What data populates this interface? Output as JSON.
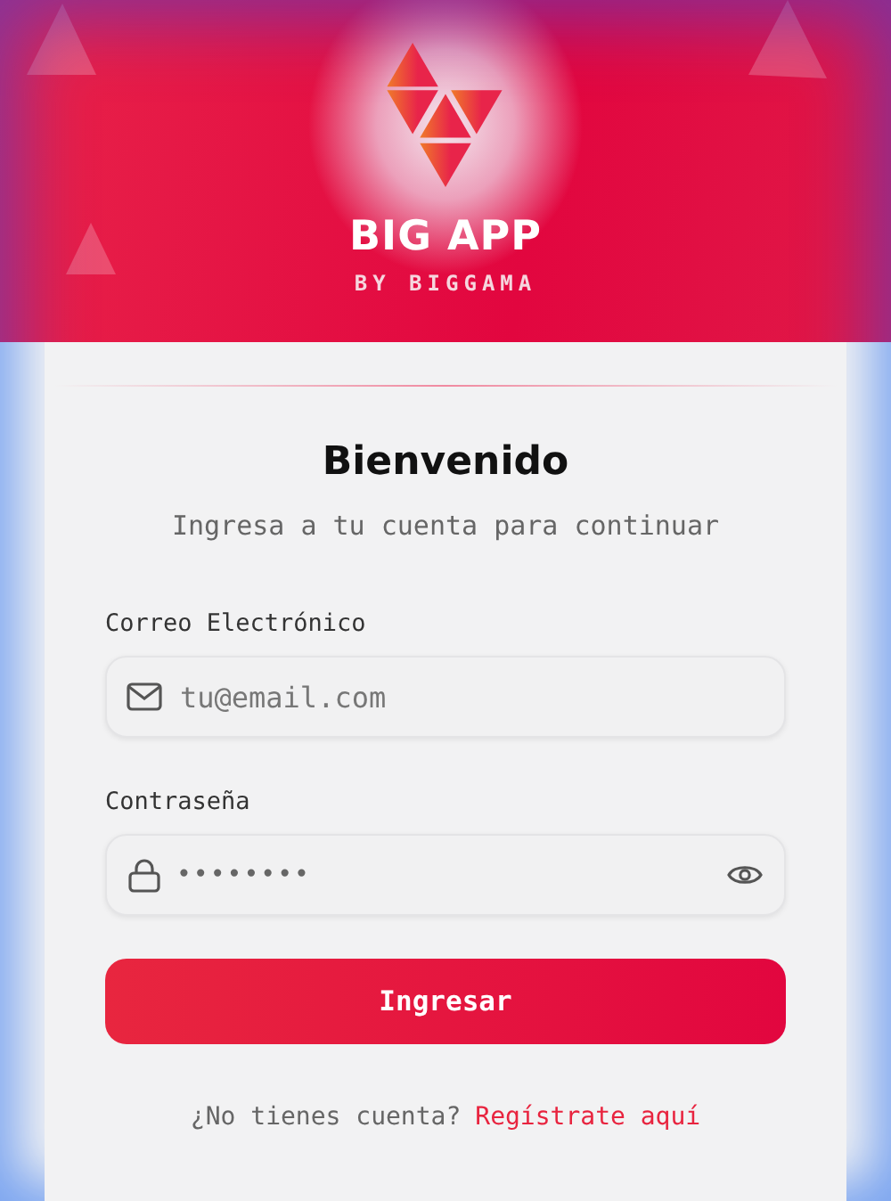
{
  "header": {
    "title": "BIG APP",
    "subtitle": "BY BIGGAMA"
  },
  "login": {
    "heading": "Bienvenido",
    "subheading": "Ingresa a tu cuenta para continuar",
    "email": {
      "label": "Correo Electrónico",
      "placeholder": "tu@email.com"
    },
    "password": {
      "label": "Contraseña",
      "value": "••••••••"
    },
    "submit": "Ingresar",
    "signup_prompt": "¿No tienes cuenta?",
    "signup_link": "Regístrate aquí"
  }
}
